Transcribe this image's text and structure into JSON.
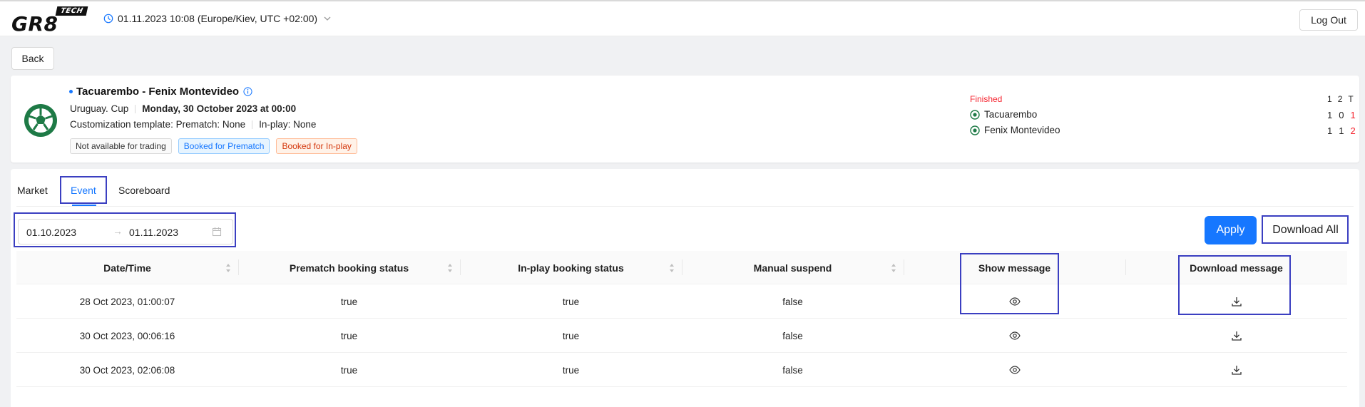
{
  "header": {
    "logo_text": "GR8",
    "logo_badge": "TECH",
    "datetime": "01.11.2023 10:08 (Europe/Kiev, UTC +02:00)",
    "logout_label": "Log Out"
  },
  "back_label": "Back",
  "event": {
    "title": "Tacuarembo - Fenix Montevideo",
    "region_league": "Uruguay. Cup",
    "date": "Monday, 30 October 2023 at 00:00",
    "customization_label": "Customization template:",
    "prematch": "Prematch: None",
    "inplay": "In-play: None",
    "tags": [
      "Not available for trading",
      "Booked for Prematch",
      "Booked for In-play"
    ],
    "status": "Finished",
    "score_header": [
      "1",
      "2",
      "T"
    ],
    "teams": [
      {
        "name": "Tacuarembo",
        "scores": [
          "1",
          "0",
          "1"
        ]
      },
      {
        "name": "Fenix Montevideo",
        "scores": [
          "1",
          "1",
          "2"
        ]
      }
    ]
  },
  "tabs": [
    {
      "label": "Market"
    },
    {
      "label": "Event"
    },
    {
      "label": "Scoreboard"
    }
  ],
  "active_tab": "Event",
  "filter": {
    "date_from": "01.10.2023",
    "date_to": "01.11.2023",
    "apply_label": "Apply",
    "download_all_label": "Download All"
  },
  "table": {
    "columns": [
      "Date/Time",
      "Prematch booking status",
      "In-play booking status",
      "Manual suspend",
      "Show message",
      "Download message"
    ],
    "rows": [
      {
        "datetime": "28 Oct 2023, 01:00:07",
        "prematch": "true",
        "inplay": "true",
        "suspend": "false"
      },
      {
        "datetime": "30 Oct 2023, 00:06:16",
        "prematch": "true",
        "inplay": "true",
        "suspend": "false"
      },
      {
        "datetime": "30 Oct 2023, 02:06:08",
        "prematch": "true",
        "inplay": "true",
        "suspend": "false"
      }
    ]
  },
  "colors": {
    "accent": "#1677ff",
    "highlight": "#3b3fc1",
    "finished": "#f5222d",
    "icon_green": "#1e7a46"
  }
}
